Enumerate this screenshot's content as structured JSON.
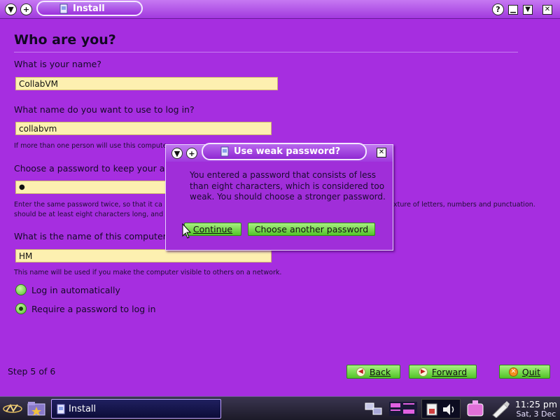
{
  "window": {
    "title": "Install"
  },
  "page": {
    "heading": "Who are you?",
    "name_question": "What is your name?",
    "name_value": "CollabVM",
    "login_question": "What name do you want to use to log in?",
    "login_value": "collabvm",
    "login_hint": "If more than one person will use this compute",
    "password_question": "Choose a password to keep your acc",
    "password_value": "●",
    "password_hint_left": "Enter the same password twice, so that it ca",
    "password_hint_left2": "should be at least eight characters long, and",
    "password_hint_right": "xture of letters, numbers and punctuation.",
    "computer_question": "What is the name of this computer?",
    "computer_value": "HM",
    "computer_hint": "This name will be used if you make the computer visible to others on a network.",
    "radio_auto": "Log in automatically",
    "radio_password": "Require a password to log in",
    "selected_option": "Require a password to log in",
    "step": "Step 5 of 6"
  },
  "buttons": {
    "back": "Back",
    "forward": "Forward",
    "quit": "Quit"
  },
  "dialog": {
    "title": "Use weak password?",
    "message": "You entered a password that consists of less than eight characters, which is considered too weak. You should choose a stronger password.",
    "continue": "Continue",
    "choose_another": "Choose another password"
  },
  "taskbar": {
    "task_label": "Install",
    "time": "11:25 pm",
    "date": "Sat, 3 Dec"
  },
  "colors": {
    "background": "#a62ee0",
    "field": "#fdf0b0",
    "button_green": "#6cd040",
    "taskbar": "#2a2740"
  },
  "icons": [
    "window-menu-icon",
    "add-icon",
    "install-app-icon",
    "help-icon",
    "minimize-icon",
    "maximize-icon",
    "close-icon",
    "back-arrow-icon",
    "forward-arrow-icon",
    "quit-icon",
    "start-menu-icon",
    "home-folder-icon",
    "network-icon",
    "keyboard-icon",
    "battery-icon",
    "volume-icon",
    "chat-icon",
    "pen-icon"
  ]
}
